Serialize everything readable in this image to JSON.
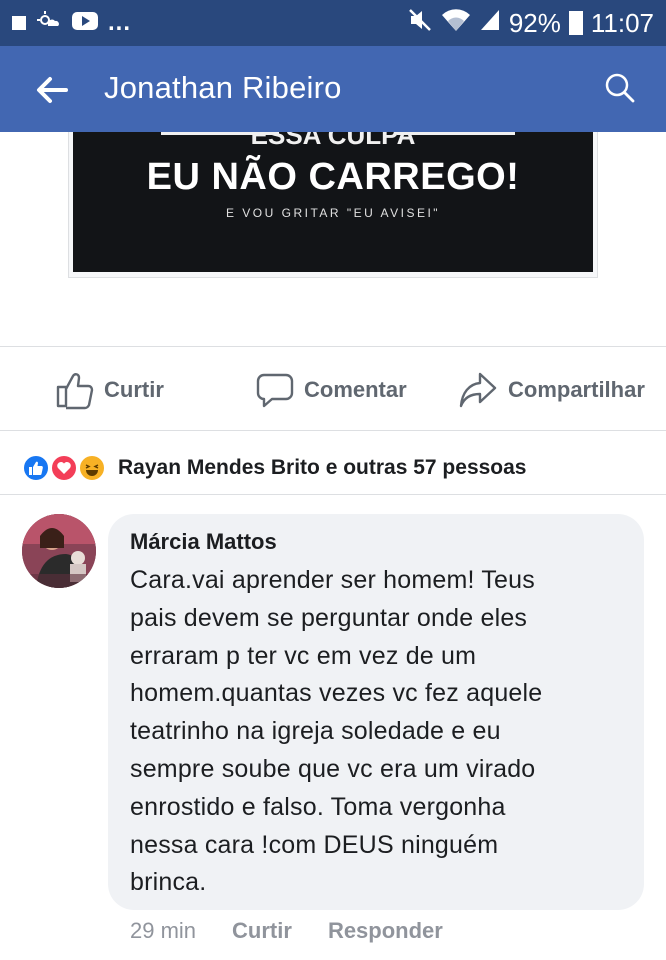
{
  "status_bar": {
    "battery": "92%",
    "time": "11:07",
    "dots": "...",
    "icons": [
      "notification-square-icon",
      "weather-icon",
      "youtube-icon",
      "mute-icon",
      "wifi-icon",
      "signal-icon",
      "battery-icon"
    ]
  },
  "app_bar": {
    "title": "Jonathan Ribeiro",
    "back_icon": "arrow-left-icon",
    "search_icon": "search-icon",
    "background": "#4267b2"
  },
  "post_image": {
    "top_text": "ESSA CULPA",
    "main_text": "EU NÃO CARREGO!",
    "sub_text": "E VOU GRITAR \"EU AVISEI\""
  },
  "actions": {
    "like": "Curtir",
    "comment": "Comentar",
    "share": "Compartilhar"
  },
  "reactions": {
    "icons": [
      "like-reaction-icon",
      "love-reaction-icon",
      "haha-reaction-icon"
    ],
    "text": "Rayan Mendes Brito e outras 57 pessoas"
  },
  "comment": {
    "author": "Márcia Mattos",
    "lines": [
      "Cara.vai aprender ser homem! Teus",
      "pais devem se perguntar onde eles",
      "erraram p ter vc em vez de um",
      "homem.quantas vezes vc fez aquele",
      "teatrinho na igreja soledade e eu",
      "sempre soube que vc era um virado",
      "enrostido e falso. Toma vergonha",
      "nessa cara !com DEUS ninguém",
      "brinca."
    ],
    "time": "29 min",
    "like": "Curtir",
    "reply": "Responder"
  }
}
